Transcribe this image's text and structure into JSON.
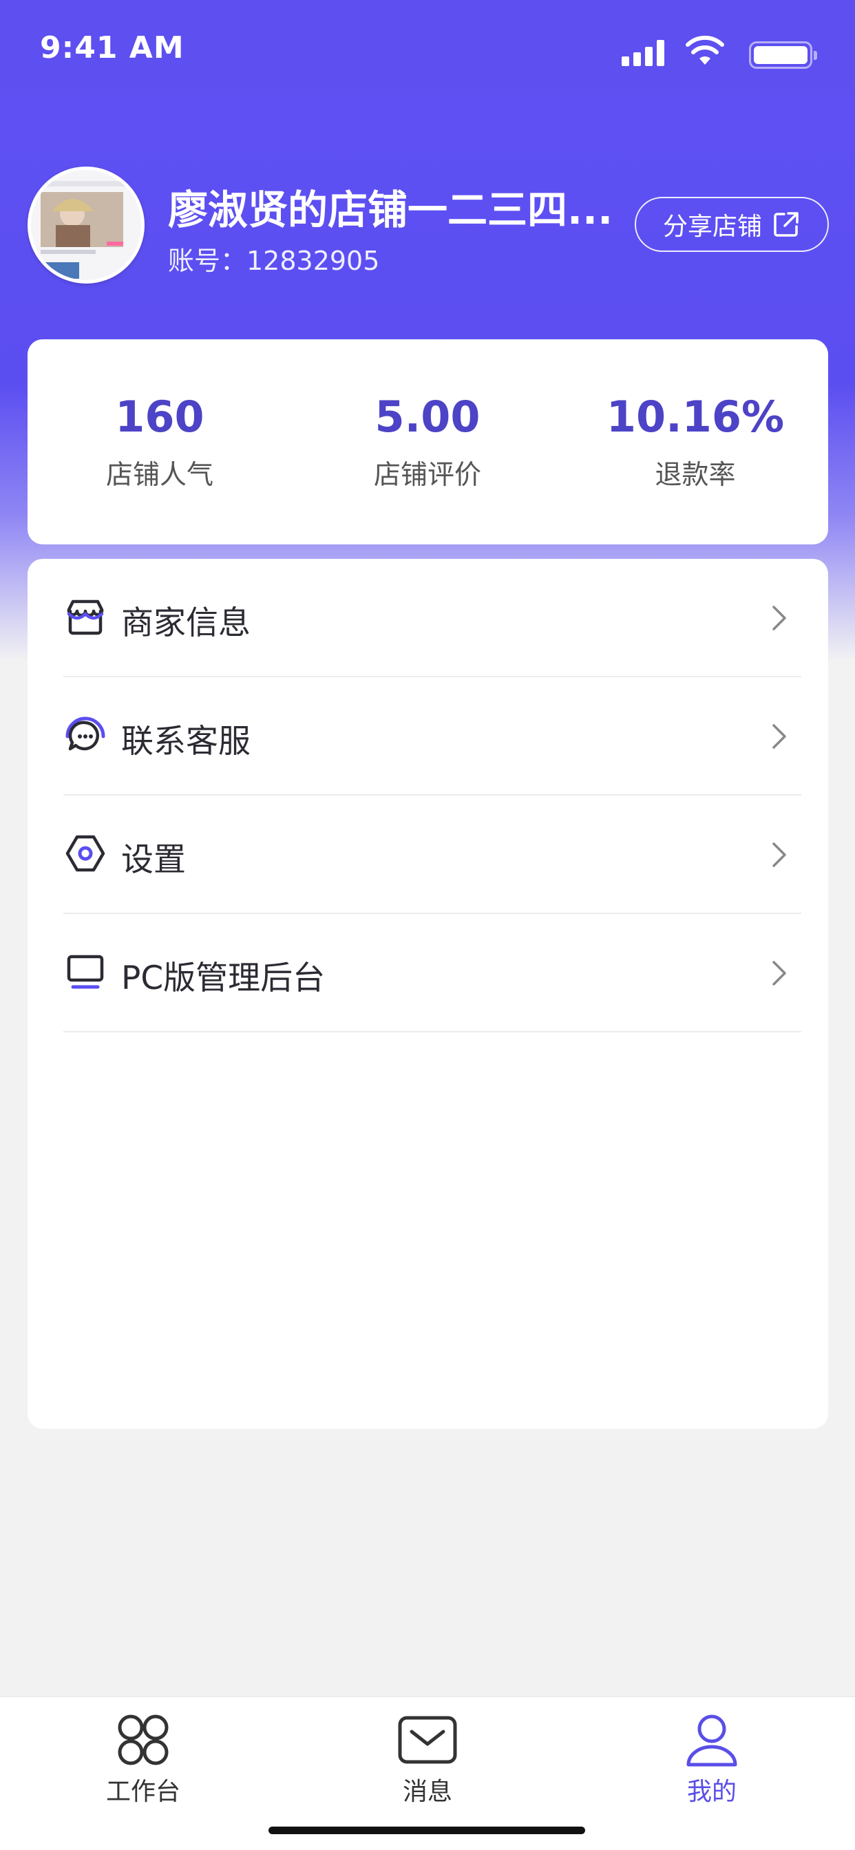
{
  "status_bar": {
    "time": "9:41 AM"
  },
  "profile": {
    "shop_name": "廖淑贤的店铺一二三四...",
    "account": "账号：12832905",
    "share_label": "分享店铺"
  },
  "stats": [
    {
      "value": "160",
      "label": "店铺人气"
    },
    {
      "value": "5.00",
      "label": "店铺评价"
    },
    {
      "value": "10.16%",
      "label": "退款率"
    }
  ],
  "menu": [
    {
      "label": "商家信息",
      "icon": "store-icon"
    },
    {
      "label": "联系客服",
      "icon": "customer-service-icon"
    },
    {
      "label": "设置",
      "icon": "settings-icon"
    },
    {
      "label": "PC版管理后台",
      "icon": "monitor-icon"
    }
  ],
  "tabbar": {
    "tabs": [
      {
        "label": "工作台",
        "icon": "grid-icon",
        "active": false
      },
      {
        "label": "消息",
        "icon": "message-icon",
        "active": false
      },
      {
        "label": "我的",
        "icon": "user-icon",
        "active": true
      }
    ]
  },
  "colors": {
    "primary": "#5b4ef1",
    "stat_value": "#4d43c6",
    "background": "#f2f2f3"
  }
}
